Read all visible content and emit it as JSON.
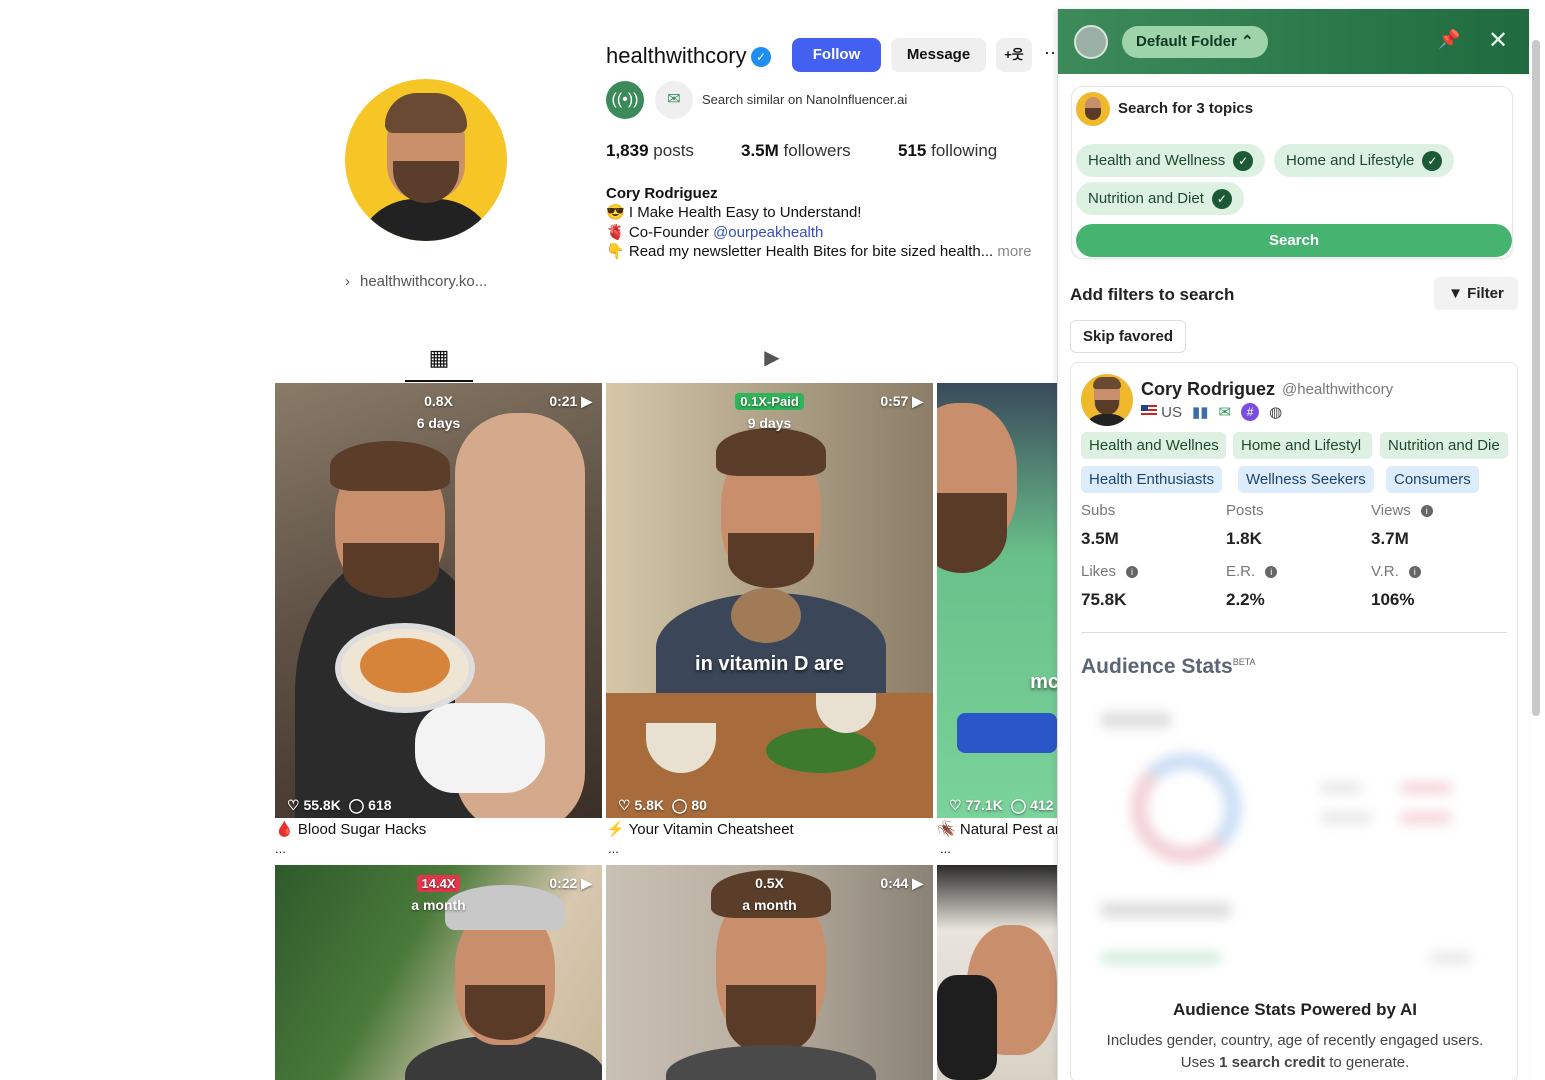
{
  "profile": {
    "username": "healthwithcory",
    "follow_label": "Follow",
    "message_label": "Message",
    "add_user_label": "+웃",
    "more_label": "··",
    "search_similar": "Search similar on NanoInfluencer.ai",
    "link_text": "healthwithcory.ko...",
    "stats": {
      "posts_value": "1,839",
      "posts_label": "posts",
      "followers_value": "3.5M",
      "followers_label": "followers",
      "following_value": "515",
      "following_label": "following"
    },
    "bio": {
      "name": "Cory Rodriguez",
      "line1_emoji": "😎",
      "line1": "I Make Health Easy to Understand!",
      "line2_emoji": "🫀",
      "line2_prefix": "Co-Founder",
      "line2_link": "@ourpeakhealth",
      "line3_emoji": "👇",
      "line3": "Read my newsletter Health Bites for bite sized health...",
      "more": "more"
    }
  },
  "posts": [
    {
      "top": "0.8X",
      "days": "6 days",
      "duration": "0:21",
      "likes": "55.8K",
      "comments": "618",
      "caption_icon": "🩸",
      "caption": "Blood Sugar Hacks",
      "ellipsis": "..."
    },
    {
      "top": "0.1X-Paid",
      "days": "9 days",
      "duration": "0:57",
      "likes": "5.8K",
      "comments": "80",
      "overlay": "in vitamin D are",
      "caption_icon": "⚡",
      "caption": "Your Vitamin Cheatsheet",
      "ellipsis": "..."
    },
    {
      "likes": "77.1K",
      "comments": "412",
      "overlay": "mc",
      "caption_icon": "🪳",
      "caption": "Natural Pest an",
      "ellipsis": "..."
    },
    {
      "top": "14.4X",
      "days": "a month",
      "duration": "0:22"
    },
    {
      "top": "0.5X",
      "days": "a month",
      "duration": "0:44"
    },
    {}
  ],
  "panel": {
    "folder_label": "Default Folder ⌃",
    "search_title": "Search for 3 topics",
    "topics": [
      "Health and Wellness",
      "Home and Lifestyle",
      "Nutrition and Diet"
    ],
    "search_button": "Search",
    "add_filters": "Add filters to search",
    "filter_button": "Filter",
    "skip_button": "Skip favored",
    "card": {
      "name": "Cory Rodriguez",
      "handle": "@healthwithcory",
      "country": "US",
      "green_tags": [
        "Health and Wellnes",
        "Home and Lifestyl",
        "Nutrition and Die"
      ],
      "blue_tags": [
        "Health Enthusiasts",
        "Wellness Seekers",
        "Consumers"
      ],
      "metrics": [
        {
          "label": "Subs",
          "value": "3.5M"
        },
        {
          "label": "Posts",
          "value": "1.8K"
        },
        {
          "label": "Views",
          "value": "3.7M"
        },
        {
          "label": "Likes",
          "value": "75.8K"
        },
        {
          "label": "E.R.",
          "value": "2.2%"
        },
        {
          "label": "V.R.",
          "value": "106%"
        }
      ],
      "audience_title": "Audience Stats",
      "audience_beta": "BETA",
      "ai_title": "Audience Stats Powered by AI",
      "ai_desc_1": "Includes gender, country, age of recently engaged users.",
      "ai_desc_2_prefix": "Uses",
      "ai_desc_2_bold": "1 search credit",
      "ai_desc_2_suffix": "to generate."
    }
  },
  "colors": {
    "follow_blue": "#4460f0",
    "panel_green": "#2f7d4c",
    "search_green": "#46b370",
    "chip_green": "#dcf1e2",
    "tag_blue": "#dcecfa"
  }
}
